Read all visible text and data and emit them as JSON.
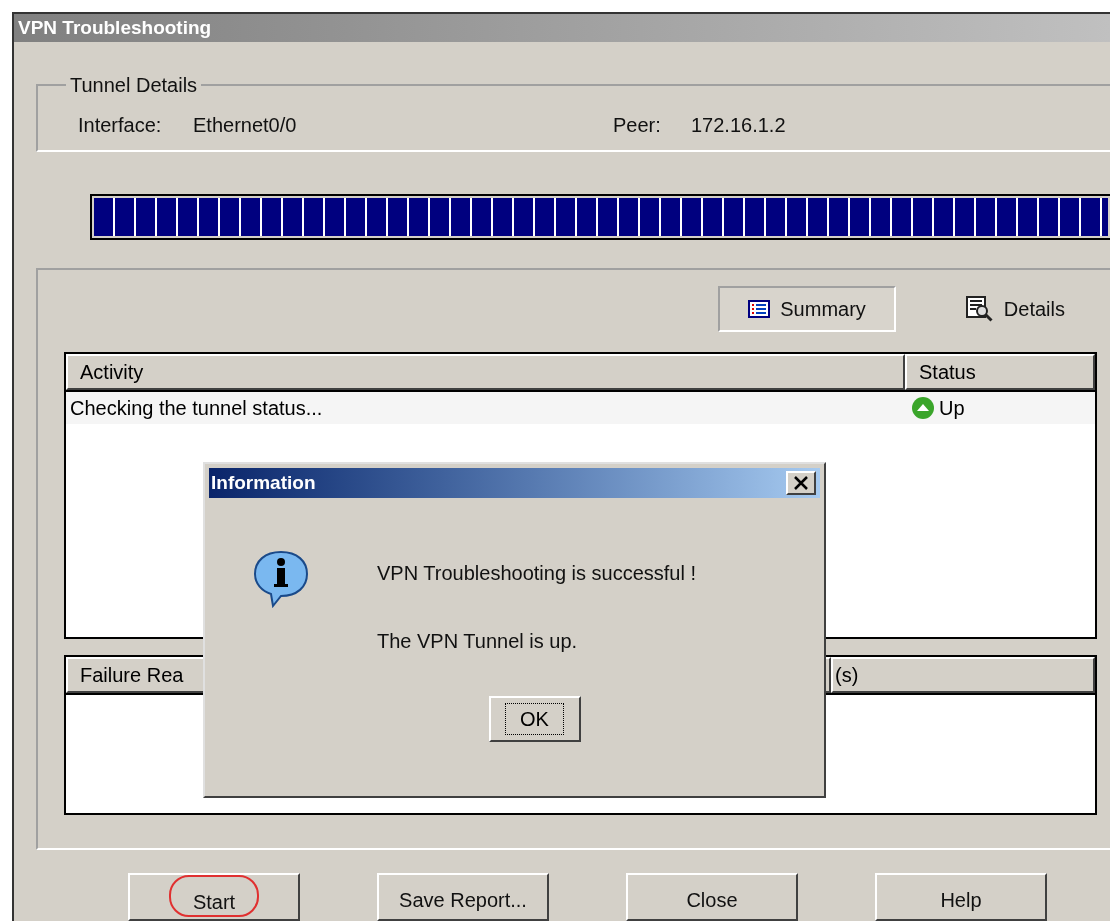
{
  "window": {
    "title": "VPN Troubleshooting"
  },
  "tunnel_details": {
    "legend": "Tunnel Details",
    "interface_label": "Interface:",
    "interface_value": "Ethernet0/0",
    "peer_label": "Peer:",
    "peer_value": "172.16.1.2"
  },
  "progress": {
    "level": 1
  },
  "view_tabs": [
    {
      "label": "Summary",
      "selected": true,
      "kind": "summary"
    },
    {
      "label": "Details",
      "selected": false,
      "kind": "details"
    }
  ],
  "activity_table": {
    "columns": [
      "Activity",
      "Status"
    ],
    "rows": [
      {
        "activity": "Checking the tunnel status...",
        "status": "Up"
      }
    ]
  },
  "failure_table": {
    "columns": [
      "Failure Rea",
      "(s)"
    ]
  },
  "buttons": [
    {
      "label": "Start",
      "annotated": true
    },
    {
      "label": "Save Report...",
      "annotated": false
    },
    {
      "label": "Close",
      "annotated": false
    },
    {
      "label": "Help",
      "annotated": false
    }
  ],
  "dialog": {
    "title": "Information",
    "lines": [
      "VPN Troubleshooting is successful !",
      "The VPN Tunnel is up."
    ],
    "button": "OK"
  }
}
